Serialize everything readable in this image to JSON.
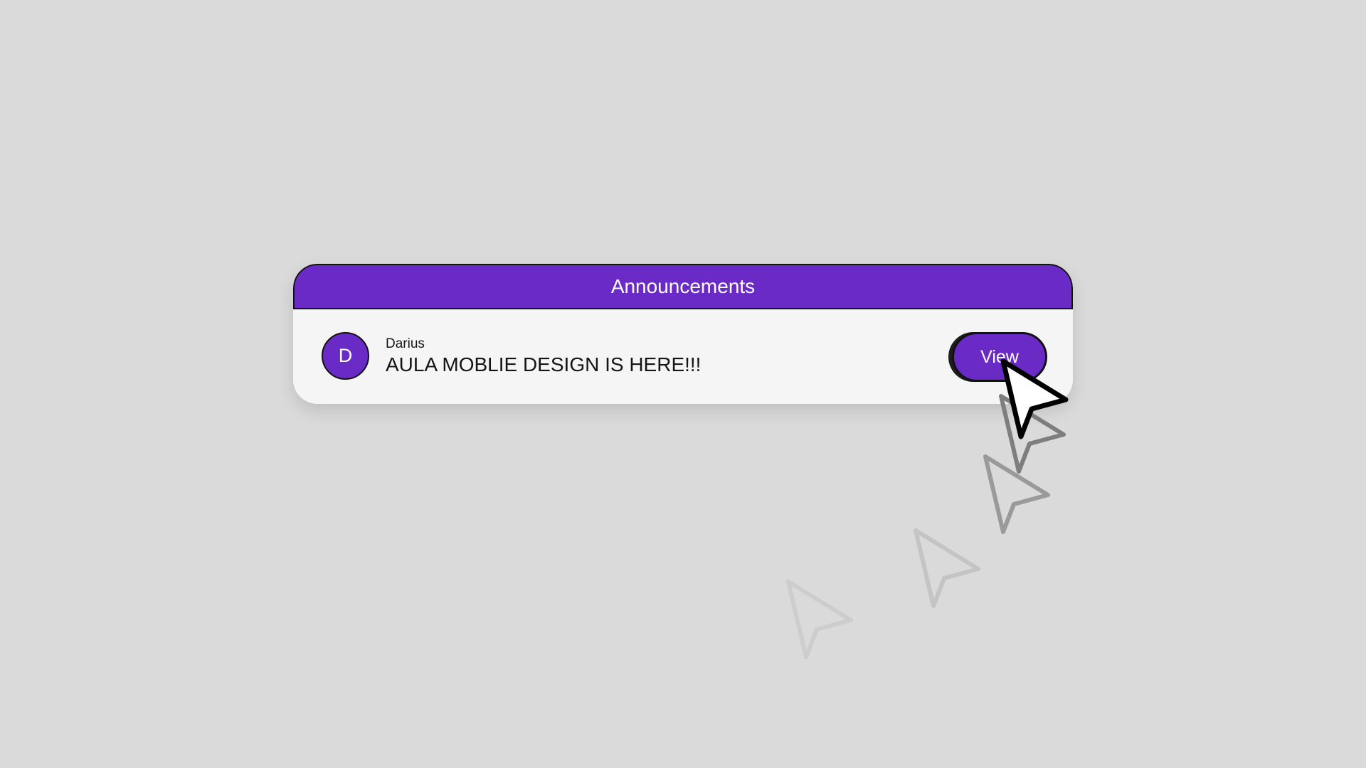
{
  "announcements": {
    "title": "Announcements",
    "items": [
      {
        "avatar_initial": "D",
        "author": "Darius",
        "message": "AULA MOBLIE DESIGN IS HERE!!!",
        "action_label": "View"
      }
    ]
  },
  "colors": {
    "accent": "#6a2ac6",
    "background": "#dadada",
    "card": "#f5f5f5",
    "outline": "#121212"
  },
  "icons": {
    "cursor": "pointer-cursor-icon"
  }
}
